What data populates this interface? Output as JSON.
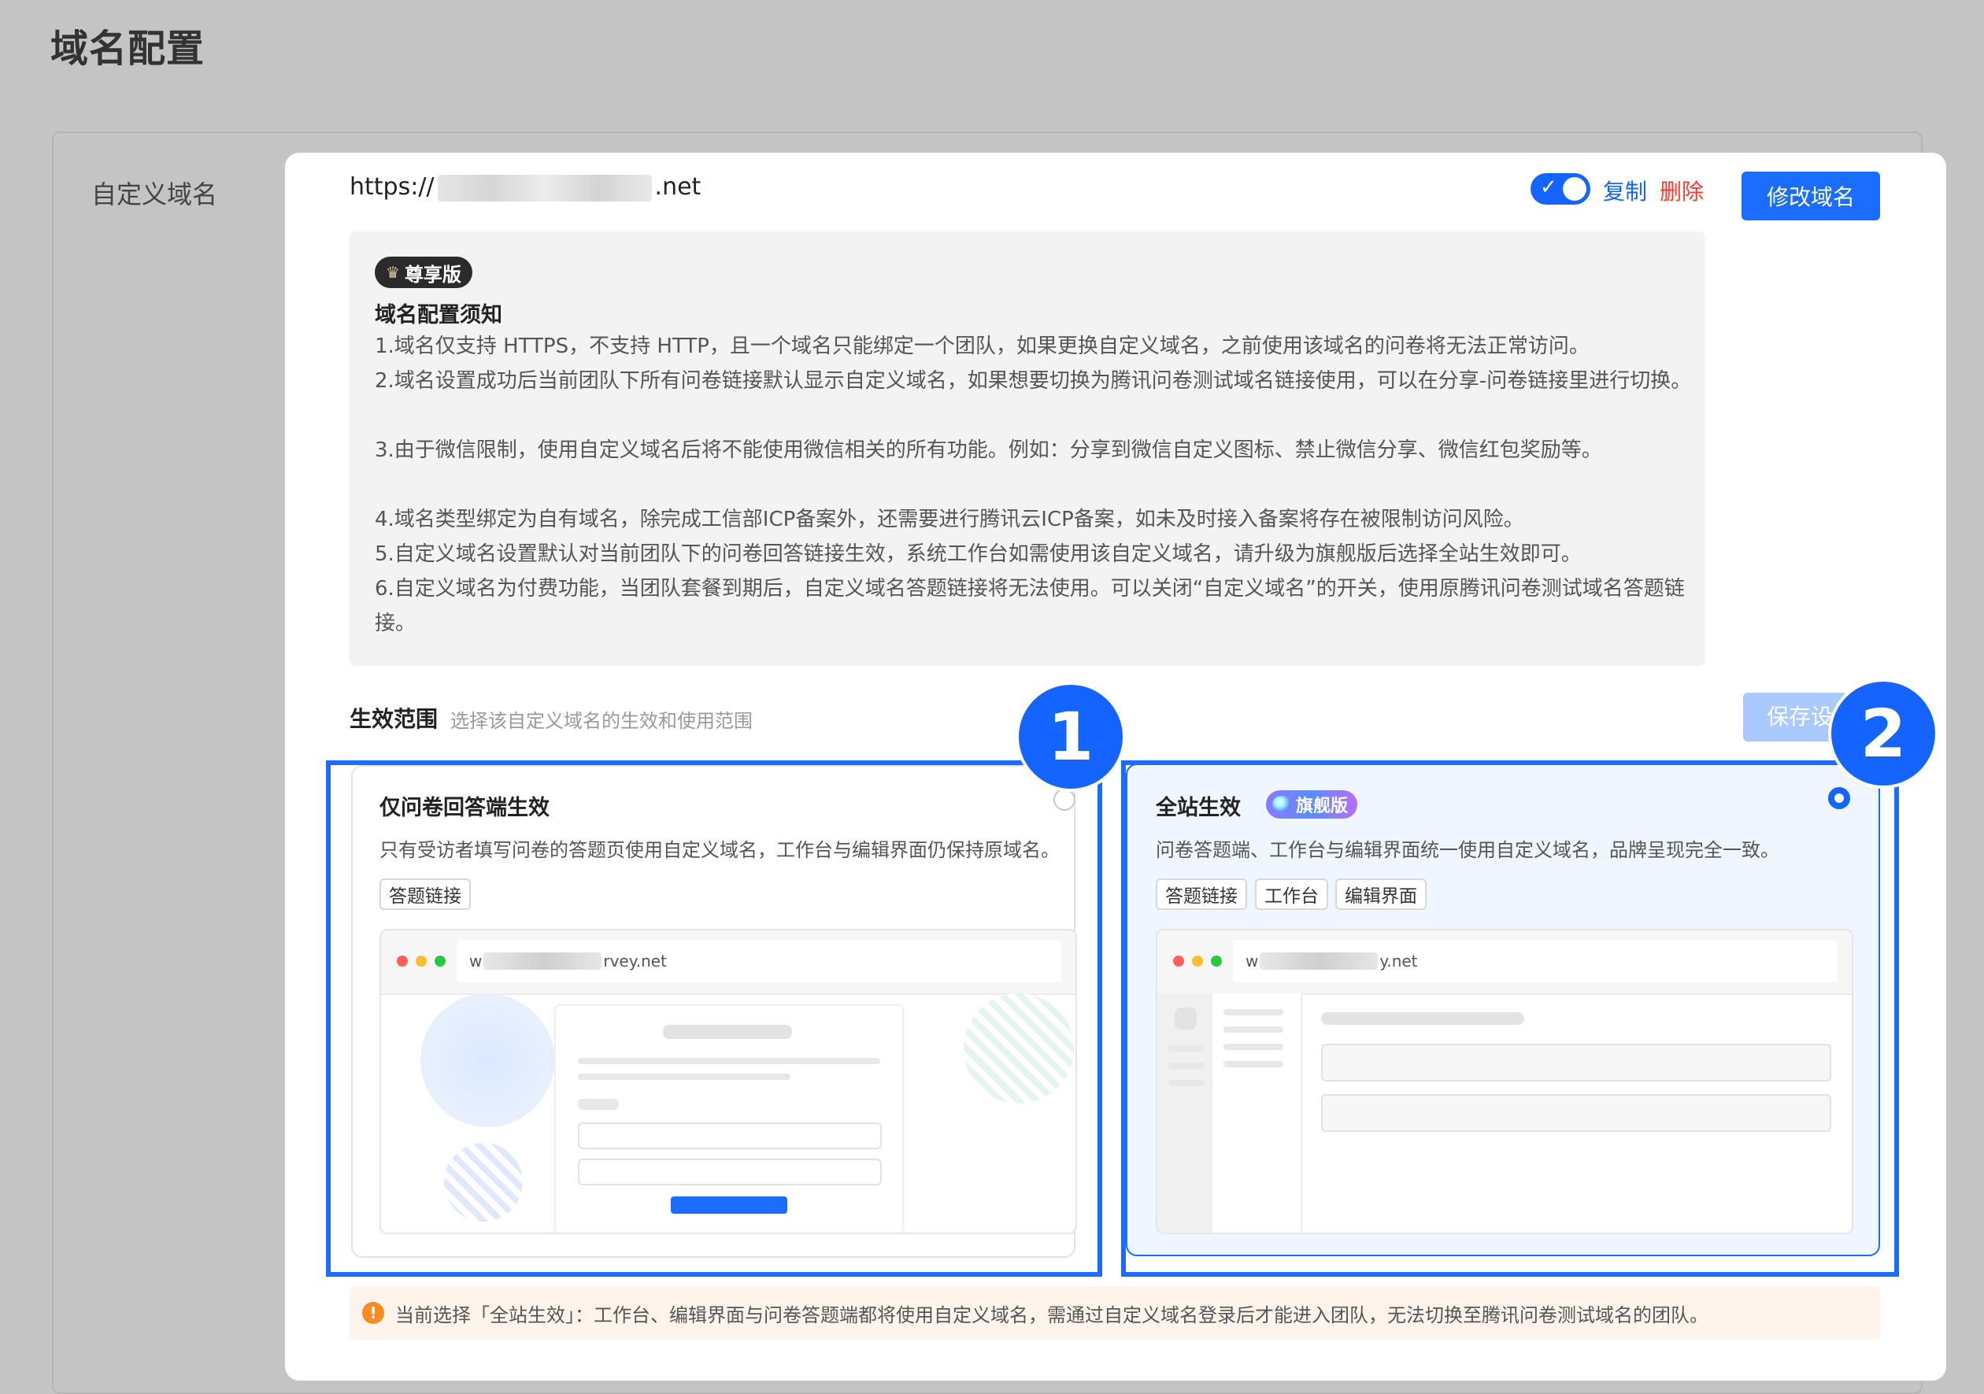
{
  "page": {
    "title": "域名配置"
  },
  "field": {
    "label": "自定义域名"
  },
  "domain": {
    "prefix": "https://",
    "suffix": ".net",
    "enabled": true
  },
  "actions": {
    "copy": "复制",
    "delete": "删除",
    "modify": "修改域名"
  },
  "notice": {
    "badge": "尊享版",
    "title": "域名配置须知",
    "items": [
      "1.域名仅支持 HTTPS，不支持 HTTP，且一个域名只能绑定一个团队，如果更换自定义域名，之前使用该域名的问卷将无法正常访问。",
      "2.域名设置成功后当前团队下所有问卷链接默认显示自定义域名，如果想要切换为腾讯问卷测试域名链接使用，可以在分享-问卷链接里进行切换。",
      "3.由于微信限制，使用自定义域名后将不能使用微信相关的所有功能。例如：分享到微信自定义图标、禁止微信分享、微信红包奖励等。",
      "4.域名类型绑定为自有域名，除完成工信部ICP备案外，还需要进行腾讯云ICP备案，如未及时接入备案将存在被限制访问风险。",
      "5.自定义域名设置默认对当前团队下的问卷回答链接生效，系统工作台如需使用该自定义域名，请升级为旗舰版后选择全站生效即可。",
      "6.自定义域名为付费功能，当团队套餐到期后，自定义域名答题链接将无法使用。可以关闭“自定义域名”的开关，使用原腾讯问卷测试域名答题链接。"
    ]
  },
  "scope": {
    "label": "生效范围",
    "sub": "选择该自定义域名的生效和使用范围",
    "save": "保存设置",
    "options": [
      {
        "title": "仅问卷回答端生效",
        "desc": "只有受访者填写问卷的答题页使用自定义域名，工作台与编辑界面仍保持原域名。",
        "tags": [
          "答题链接"
        ],
        "selected": false,
        "preview_prefix": "w",
        "preview_suffix": "rvey.net"
      },
      {
        "title": "全站生效",
        "badge": "旗舰版",
        "desc": "问卷答题端、工作台与编辑界面统一使用自定义域名，品牌呈现完全一致。",
        "tags": [
          "答题链接",
          "工作台",
          "编辑界面"
        ],
        "selected": true,
        "preview_prefix": "w",
        "preview_suffix": "y.net"
      }
    ]
  },
  "callouts": [
    "1",
    "2"
  ],
  "warning": "当前选择「全站生效」：工作台、编辑界面与问卷答题端都将使用自定义域名，需通过自定义域名登录后才能进入团队，无法切换至腾讯问卷测试域名的团队。",
  "colors": {
    "primary": "#1664ff",
    "danger": "#ff3b30",
    "warn": "#ff8a1e"
  }
}
